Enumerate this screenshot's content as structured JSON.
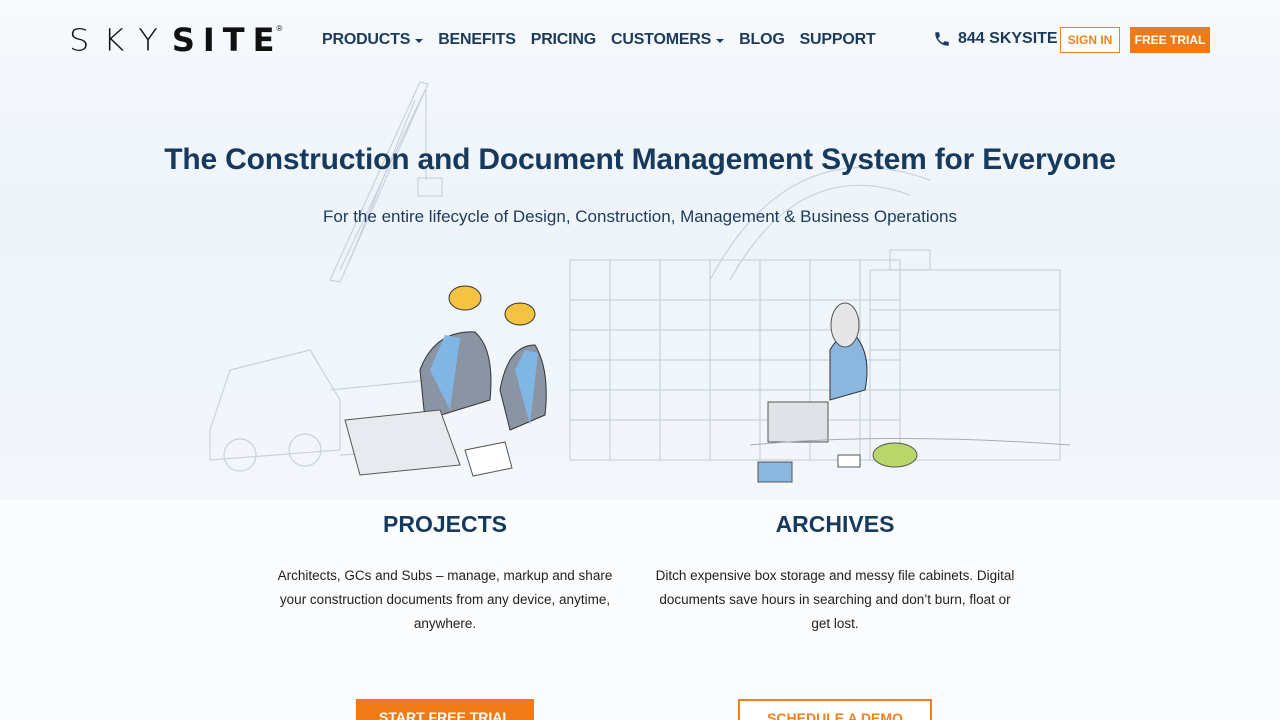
{
  "brand": {
    "logo_light": "SKY",
    "logo_bold": "SITE",
    "logo_mark": "®"
  },
  "nav": {
    "items": [
      {
        "label": "PRODUCTS",
        "has_dropdown": true
      },
      {
        "label": "BENEFITS",
        "has_dropdown": false
      },
      {
        "label": "PRICING",
        "has_dropdown": false
      },
      {
        "label": "CUSTOMERS",
        "has_dropdown": true
      },
      {
        "label": "BLOG",
        "has_dropdown": false
      },
      {
        "label": "SUPPORT",
        "has_dropdown": false
      }
    ],
    "phone": {
      "icon": "phone-icon",
      "label": "844 SKYSITE"
    },
    "sign_in": "SIGN IN",
    "free_trial": "FREE TRIAL"
  },
  "hero": {
    "title": "The Construction and Document Management System for Everyone",
    "subtitle": "For the entire lifecycle of Design, Construction, Management & Business Operations"
  },
  "columns": [
    {
      "title": "PROJECTS",
      "text": "Architects, GCs and Subs – manage, markup and share your construction documents from any device, anytime, anywhere.",
      "button": "START FREE TRIAL"
    },
    {
      "title": "ARCHIVES",
      "text": "Ditch expensive box storage and messy file cabinets. Digital documents save hours in searching and don’t burn, float or get lost.",
      "button": "SCHEDULE A DEMO"
    }
  ],
  "colors": {
    "accent": "#f07a16",
    "navy": "#16395e"
  }
}
